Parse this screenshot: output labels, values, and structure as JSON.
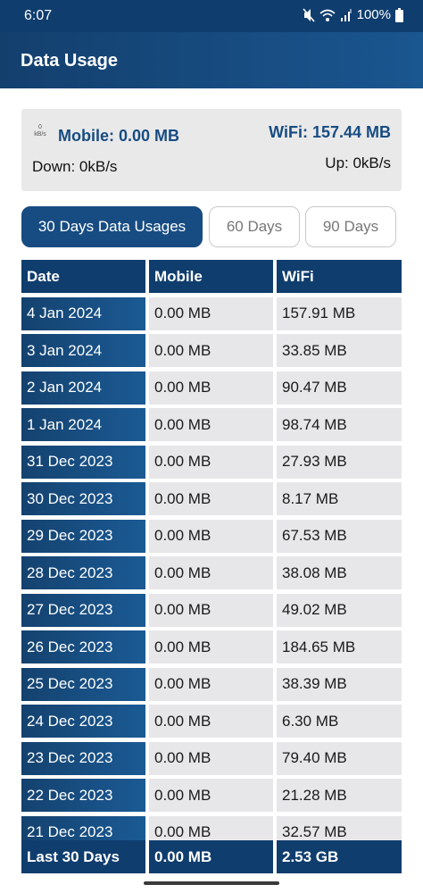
{
  "status_bar": {
    "time": "6:07",
    "battery": "100%",
    "icons": [
      "mute-icon",
      "wifi-icon",
      "signal-icon",
      "battery-icon"
    ]
  },
  "app_bar": {
    "title": "Data Usage"
  },
  "summary": {
    "speed_value": "0",
    "speed_unit": "kB/s",
    "mobile": "Mobile: 0.00 MB",
    "wifi": "WiFi: 157.44 MB",
    "down": "Down: 0kB/s",
    "up": "Up: 0kB/s"
  },
  "tabs": [
    {
      "label": "30 Days Data Usages",
      "active": true
    },
    {
      "label": "60 Days",
      "active": false
    },
    {
      "label": "90 Days",
      "active": false
    }
  ],
  "table": {
    "headers": [
      "Date",
      "Mobile",
      "WiFi"
    ],
    "rows": [
      [
        "4 Jan 2024",
        "0.00 MB",
        "157.91 MB"
      ],
      [
        "3 Jan 2024",
        "0.00 MB",
        "33.85 MB"
      ],
      [
        "2 Jan 2024",
        "0.00 MB",
        "90.47 MB"
      ],
      [
        "1 Jan 2024",
        "0.00 MB",
        "98.74 MB"
      ],
      [
        "31 Dec 2023",
        "0.00 MB",
        "27.93 MB"
      ],
      [
        "30 Dec 2023",
        "0.00 MB",
        "8.17 MB"
      ],
      [
        "29 Dec 2023",
        "0.00 MB",
        "67.53 MB"
      ],
      [
        "28 Dec 2023",
        "0.00 MB",
        "38.08 MB"
      ],
      [
        "27 Dec 2023",
        "0.00 MB",
        "49.02 MB"
      ],
      [
        "26 Dec 2023",
        "0.00 MB",
        "184.65 MB"
      ],
      [
        "25 Dec 2023",
        "0.00 MB",
        "38.39 MB"
      ],
      [
        "24 Dec 2023",
        "0.00 MB",
        "6.30 MB"
      ],
      [
        "23 Dec 2023",
        "0.00 MB",
        "79.40 MB"
      ],
      [
        "22 Dec 2023",
        "0.00 MB",
        "21.28 MB"
      ],
      [
        "21 Dec 2023",
        "0.00 MB",
        "32.57 MB"
      ]
    ],
    "footer": [
      "Last 30 Days",
      "0.00 MB",
      "2.53 GB"
    ]
  },
  "colors": {
    "primary": "#174c82",
    "header_dark": "#0f3d6e",
    "cell_gray": "#e7e7e9",
    "card_gray": "#e9e9ea"
  }
}
